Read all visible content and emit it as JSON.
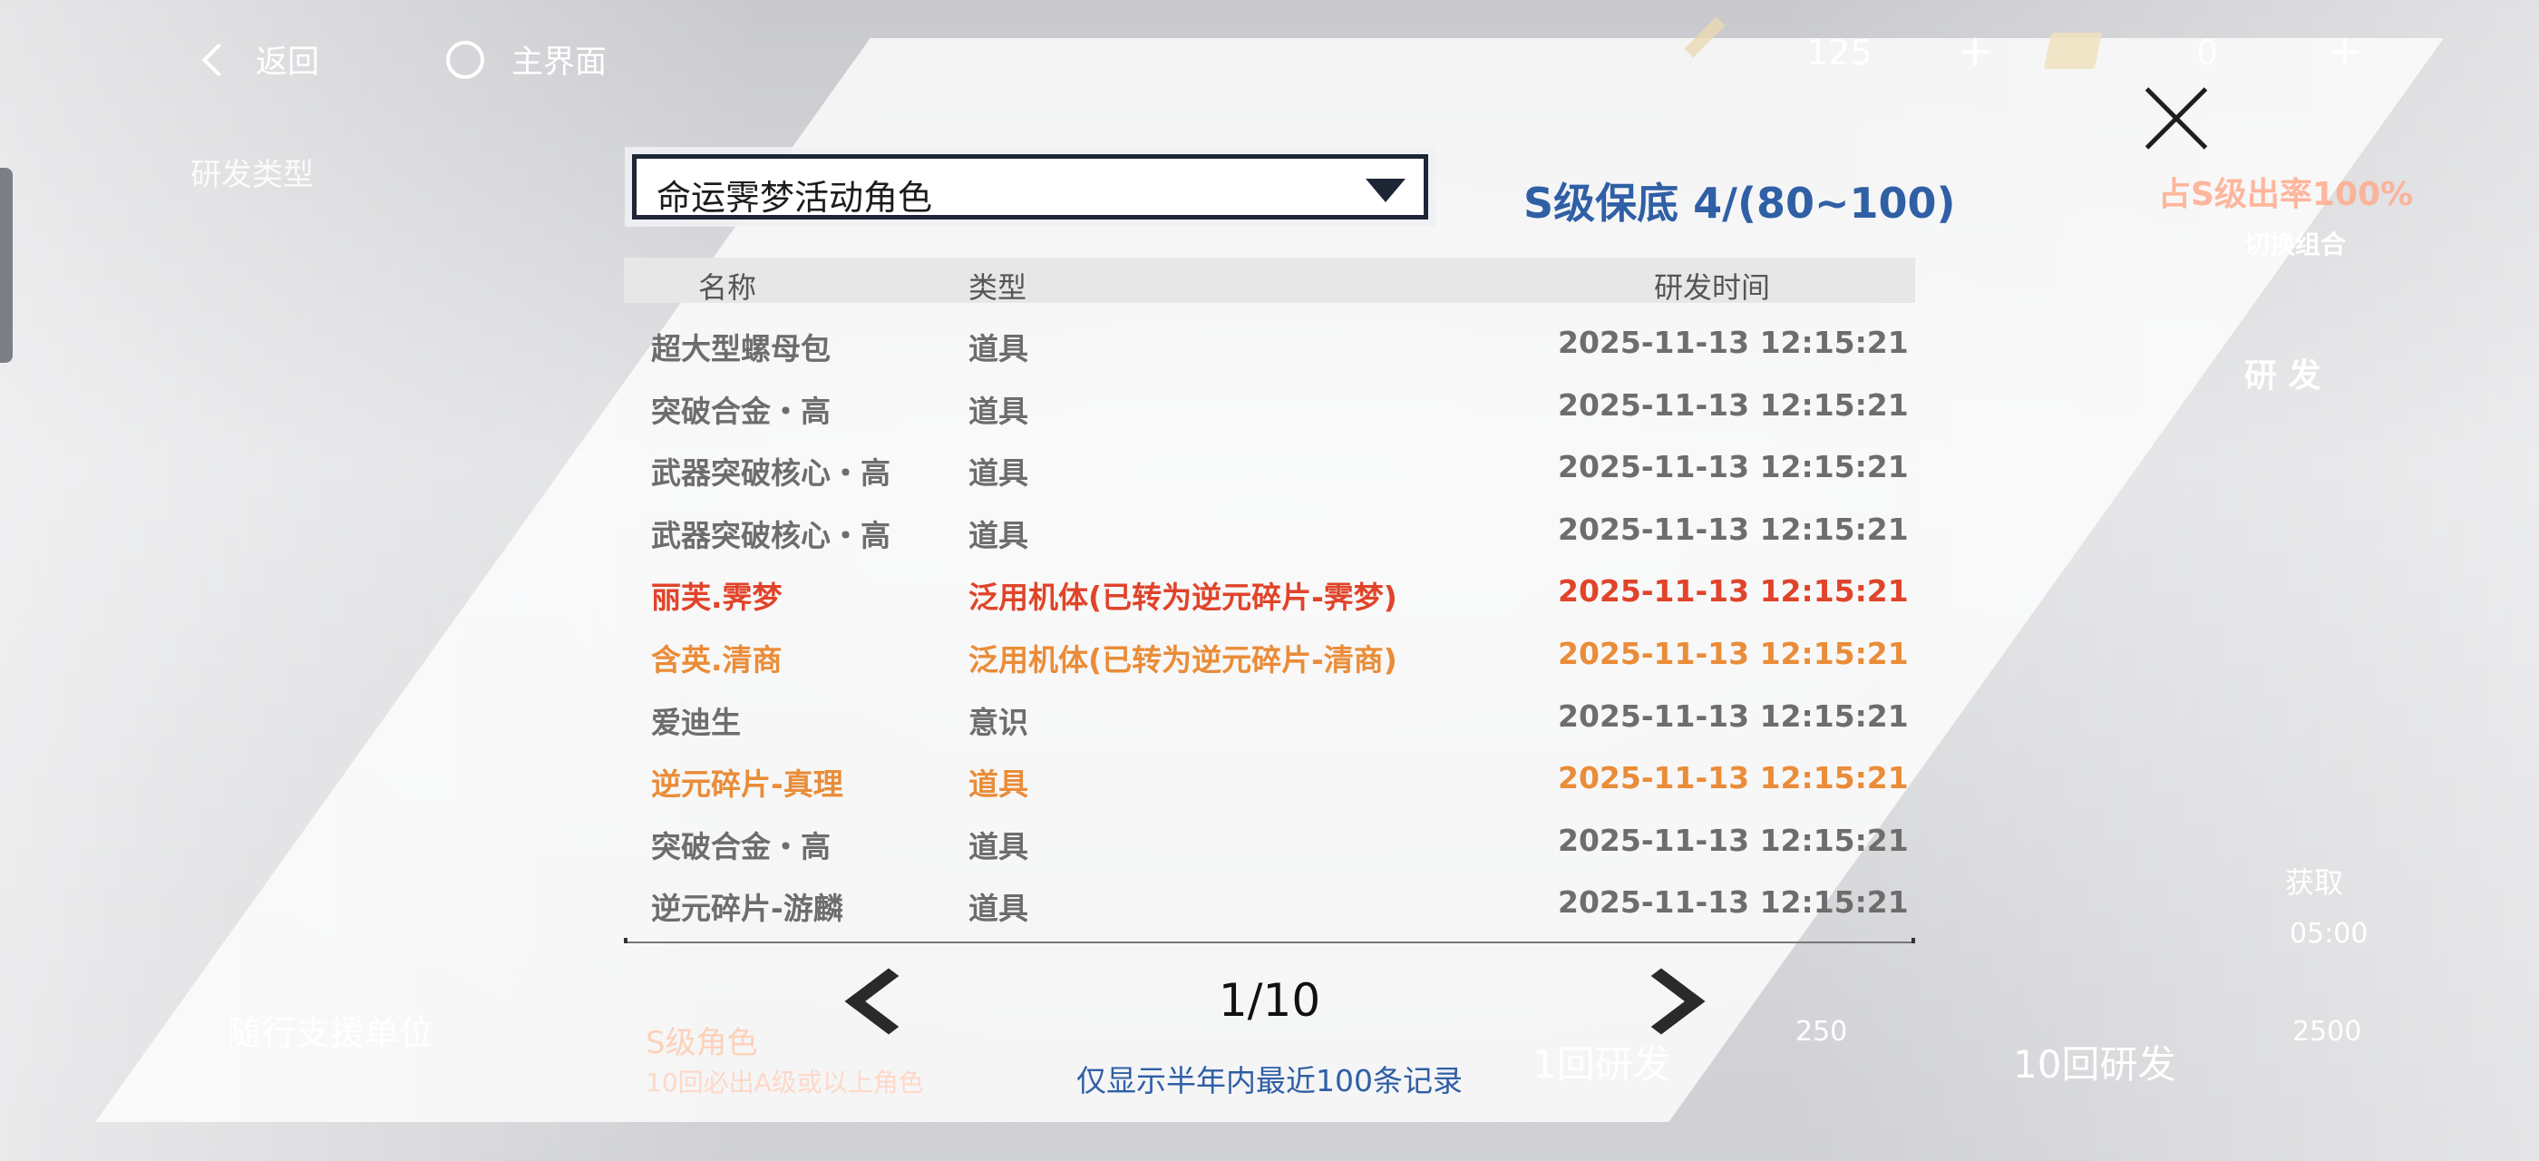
{
  "topbar": {
    "back_label": "返回",
    "home_label": "主界面",
    "currency1": "125",
    "currency2": "0",
    "plus": "+"
  },
  "background": {
    "dev_type": "研发类型",
    "support_unit": "随行支援单位",
    "s_char": "S级角色",
    "ten_roll_note": "10回必出A级或以上角色",
    "one_roll": "1回研发",
    "ten_roll": "10回研发",
    "cost_one": "250",
    "cost_ten": "2500",
    "rate": "占S级出率100%",
    "switch": "切换组合",
    "research": "研 发",
    "obtain": "获取",
    "timer": "05:00"
  },
  "panel": {
    "pool_select": "命运霁梦活动角色",
    "pity": "S级保底 4/(80~100)",
    "columns": [
      "名称",
      "类型",
      "研发时间"
    ],
    "rows": [
      {
        "name": "超大型螺母包",
        "type": "道具",
        "time": "2025-11-13 12:15:21",
        "color": "#6d6d6d"
      },
      {
        "name": "突破合金・高",
        "type": "道具",
        "time": "2025-11-13 12:15:21",
        "color": "#6d6d6d"
      },
      {
        "name": "武器突破核心・高",
        "type": "道具",
        "time": "2025-11-13 12:15:21",
        "color": "#6d6d6d"
      },
      {
        "name": "武器突破核心・高",
        "type": "道具",
        "time": "2025-11-13 12:15:21",
        "color": "#6d6d6d"
      },
      {
        "name": "丽芙.霁梦",
        "type": "泛用机体(已转为逆元碎片-霁梦)",
        "time": "2025-11-13 12:15:21",
        "color": "#e0442a"
      },
      {
        "name": "含英.清商",
        "type": "泛用机体(已转为逆元碎片-清商)",
        "time": "2025-11-13 12:15:21",
        "color": "#ea8c38"
      },
      {
        "name": "爱迪生",
        "type": "意识",
        "time": "2025-11-13 12:15:21",
        "color": "#6d6d6d"
      },
      {
        "name": "逆元碎片-真理",
        "type": "道具",
        "time": "2025-11-13 12:15:21",
        "color": "#ea8c38"
      },
      {
        "name": "突破合金・高",
        "type": "道具",
        "time": "2025-11-13 12:15:21",
        "color": "#6d6d6d"
      },
      {
        "name": "逆元碎片-游麟",
        "type": "道具",
        "time": "2025-11-13 12:15:21",
        "color": "#6d6d6d"
      }
    ],
    "page": "1/10",
    "note": "仅显示半年内最近100条记录"
  }
}
